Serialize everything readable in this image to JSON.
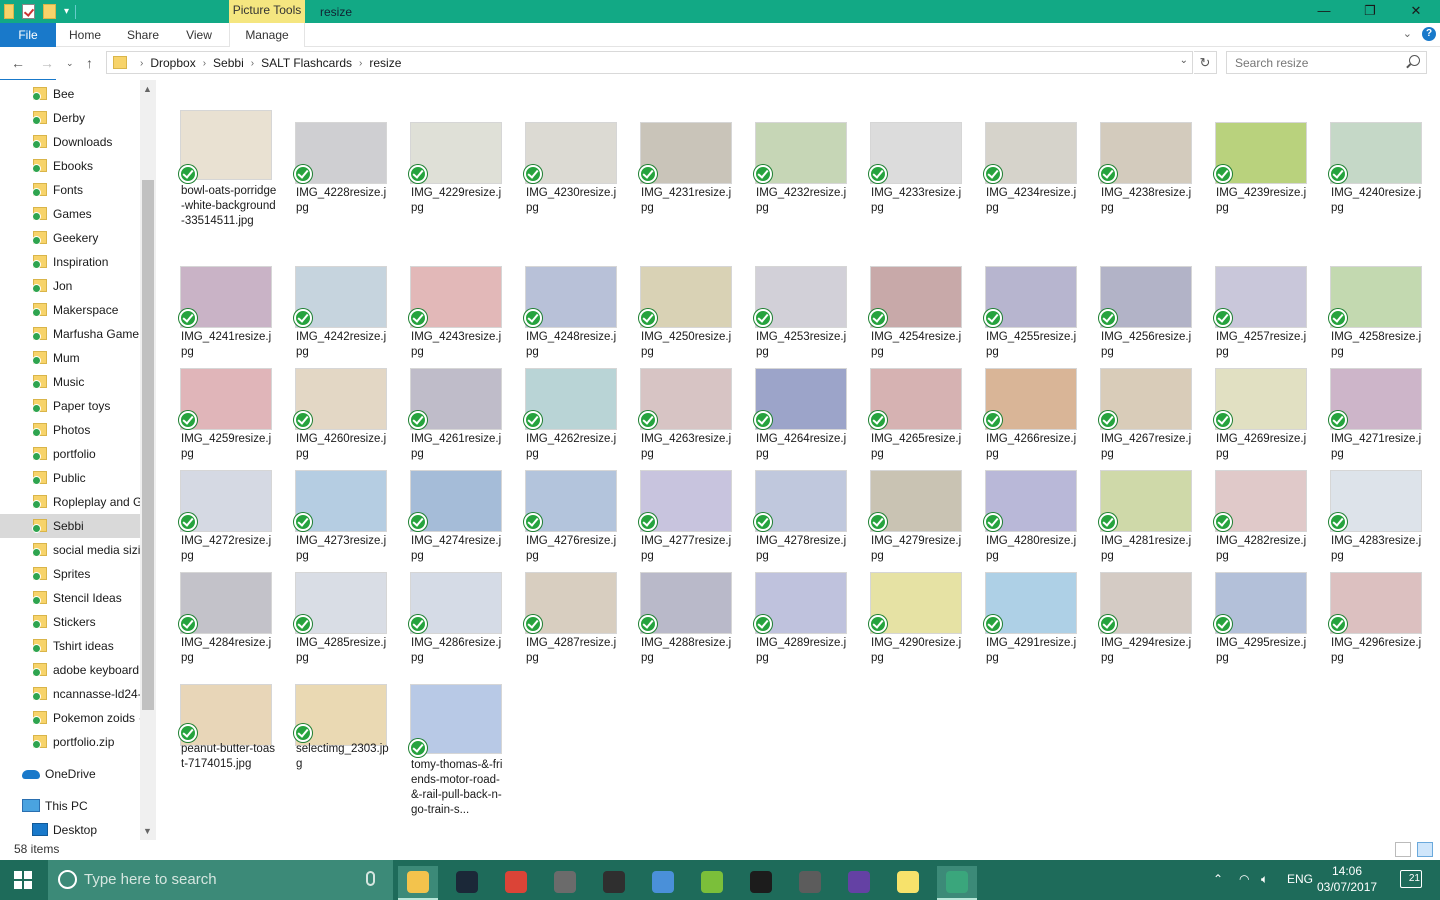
{
  "window": {
    "title": "resize",
    "contextual_tab": "Picture Tools",
    "controls": {
      "minimize": "—",
      "maximize": "❐",
      "close": "✕"
    }
  },
  "ribbon": {
    "tabs": [
      "File",
      "Home",
      "Share",
      "View",
      "Manage"
    ],
    "help": "?"
  },
  "addressbar": {
    "breadcrumbs": [
      "Dropbox",
      "Sebbi",
      "SALT Flashcards",
      "resize"
    ],
    "search_placeholder": "Search resize"
  },
  "sidebar": {
    "folders": [
      "Bee",
      "Derby",
      "Downloads",
      "Ebooks",
      "Fonts",
      "Games",
      "Geekery",
      "Inspiration",
      "Jon",
      "Makerspace",
      "Marfusha Game",
      "Mum",
      "Music",
      "Paper toys",
      "Photos",
      "portfolio",
      "Public",
      "Ropleplay and G",
      "Sebbi",
      "social media sizi",
      "Sprites",
      "Stencil Ideas",
      "Stickers",
      "Tshirt ideas",
      "adobe keyboard",
      "ncannasse-ld24-",
      "Pokemon zoids ·",
      "portfolio.zip"
    ],
    "selected": "Sebbi",
    "onedrive": "OneDrive",
    "this_pc": "This PC",
    "desktop": "Desktop"
  },
  "files": [
    {
      "name": "bowl-oats-porridge-white-background-33514511.jpg",
      "color": "#e9e1d2"
    },
    {
      "name": "IMG_4228resize.jpg",
      "color": "#cfcfd2"
    },
    {
      "name": "IMG_4229resize.jpg",
      "color": "#dfe0d7"
    },
    {
      "name": "IMG_4230resize.jpg",
      "color": "#dcdad3"
    },
    {
      "name": "IMG_4231resize.jpg",
      "color": "#c9c4b9"
    },
    {
      "name": "IMG_4232resize.jpg",
      "color": "#c6d6b6"
    },
    {
      "name": "IMG_4233resize.jpg",
      "color": "#dcdcdc"
    },
    {
      "name": "IMG_4234resize.jpg",
      "color": "#d6d3cb"
    },
    {
      "name": "IMG_4238resize.jpg",
      "color": "#d3cbbd"
    },
    {
      "name": "IMG_4239resize.jpg",
      "color": "#b9d27d"
    },
    {
      "name": "IMG_4240resize.jpg",
      "color": "#c5d8c7"
    },
    {
      "name": "IMG_4241resize.jpg",
      "color": "#c9b3c6"
    },
    {
      "name": "IMG_4242resize.jpg",
      "color": "#c6d4de"
    },
    {
      "name": "IMG_4243resize.jpg",
      "color": "#e2b8b8"
    },
    {
      "name": "IMG_4248resize.jpg",
      "color": "#b8c1d8"
    },
    {
      "name": "IMG_4250resize.jpg",
      "color": "#d9d2b5"
    },
    {
      "name": "IMG_4253resize.jpg",
      "color": "#d2d0d8"
    },
    {
      "name": "IMG_4254resize.jpg",
      "color": "#c8a9a9"
    },
    {
      "name": "IMG_4255resize.jpg",
      "color": "#b7b5cf"
    },
    {
      "name": "IMG_4256resize.jpg",
      "color": "#b2b3c7"
    },
    {
      "name": "IMG_4257resize.jpg",
      "color": "#c9c7da"
    },
    {
      "name": "IMG_4258resize.jpg",
      "color": "#c3d9b0"
    },
    {
      "name": "IMG_4259resize.jpg",
      "color": "#e0b5b9"
    },
    {
      "name": "IMG_4260resize.jpg",
      "color": "#e3d7c5"
    },
    {
      "name": "IMG_4261resize.jpg",
      "color": "#bfbcc9"
    },
    {
      "name": "IMG_4262resize.jpg",
      "color": "#b9d4d6"
    },
    {
      "name": "IMG_4263resize.jpg",
      "color": "#d7c4c4"
    },
    {
      "name": "IMG_4264resize.jpg",
      "color": "#9ca4c9"
    },
    {
      "name": "IMG_4265resize.jpg",
      "color": "#d6b2b2"
    },
    {
      "name": "IMG_4266resize.jpg",
      "color": "#d9b597"
    },
    {
      "name": "IMG_4267resize.jpg",
      "color": "#d9ccb9"
    },
    {
      "name": "IMG_4269resize.jpg",
      "color": "#e1e0c2"
    },
    {
      "name": "IMG_4271resize.jpg",
      "color": "#cdb5c9"
    },
    {
      "name": "IMG_4272resize.jpg",
      "color": "#d5d9e3"
    },
    {
      "name": "IMG_4273resize.jpg",
      "color": "#b5cde2"
    },
    {
      "name": "IMG_4274resize.jpg",
      "color": "#a5bcd8"
    },
    {
      "name": "IMG_4276resize.jpg",
      "color": "#b3c4dc"
    },
    {
      "name": "IMG_4277resize.jpg",
      "color": "#c8c4de"
    },
    {
      "name": "IMG_4278resize.jpg",
      "color": "#c0c8dd"
    },
    {
      "name": "IMG_4279resize.jpg",
      "color": "#c9c3b3"
    },
    {
      "name": "IMG_4280resize.jpg",
      "color": "#b9b8d8"
    },
    {
      "name": "IMG_4281resize.jpg",
      "color": "#cfd9a9"
    },
    {
      "name": "IMG_4282resize.jpg",
      "color": "#e0c9c9"
    },
    {
      "name": "IMG_4283resize.jpg",
      "color": "#dde3ea"
    },
    {
      "name": "IMG_4284resize.jpg",
      "color": "#c3c2c9"
    },
    {
      "name": "IMG_4285resize.jpg",
      "color": "#d9dde5"
    },
    {
      "name": "IMG_4286resize.jpg",
      "color": "#d5dbe6"
    },
    {
      "name": "IMG_4287resize.jpg",
      "color": "#d8cec0"
    },
    {
      "name": "IMG_4288resize.jpg",
      "color": "#b9b9c9"
    },
    {
      "name": "IMG_4289resize.jpg",
      "color": "#bfc2dd"
    },
    {
      "name": "IMG_4290resize.jpg",
      "color": "#e6e2a4"
    },
    {
      "name": "IMG_4291resize.jpg",
      "color": "#aed0e6"
    },
    {
      "name": "IMG_4294resize.jpg",
      "color": "#d4cbc4"
    },
    {
      "name": "IMG_4295resize.jpg",
      "color": "#b3c0d9"
    },
    {
      "name": "IMG_4296resize.jpg",
      "color": "#dcc0c0"
    },
    {
      "name": "peanut-butter-toast-7174015.jpg",
      "color": "#e8d6b8"
    },
    {
      "name": "selectimg_2303.jpg",
      "color": "#ead9b3"
    },
    {
      "name": "tomy-thomas-&-friends-motor-road-&-rail-pull-back-n-go-train-s...",
      "color": "#b8c9e6"
    }
  ],
  "status": {
    "item_count": "58 items"
  },
  "taskbar": {
    "search_placeholder": "Type here to search",
    "language": "ENG",
    "time": "14:06",
    "date": "03/07/2017",
    "notifications": "21",
    "apps": [
      {
        "icon": "file-explorer-icon",
        "color": "#f3c34c",
        "active": true
      },
      {
        "icon": "steam-icon",
        "color": "#1b2838"
      },
      {
        "icon": "chrome-icon",
        "color": "#db4437"
      },
      {
        "icon": "drone-app-icon",
        "color": "#6b6b6b"
      },
      {
        "icon": "inkscape-icon",
        "color": "#2f2f2f"
      },
      {
        "icon": "blender-like-icon",
        "color": "#4a90d9"
      },
      {
        "icon": "green-app-icon",
        "color": "#7bbf3a"
      },
      {
        "icon": "ida-icon",
        "color": "#1c1c1c"
      },
      {
        "icon": "calculator-icon",
        "color": "#5c5c5c"
      },
      {
        "icon": "twitch-icon",
        "color": "#6441a4"
      },
      {
        "icon": "sticky-notes-icon",
        "color": "#f7e26b"
      },
      {
        "icon": "slack-icon",
        "color": "#3aa67c",
        "active": true
      }
    ]
  }
}
